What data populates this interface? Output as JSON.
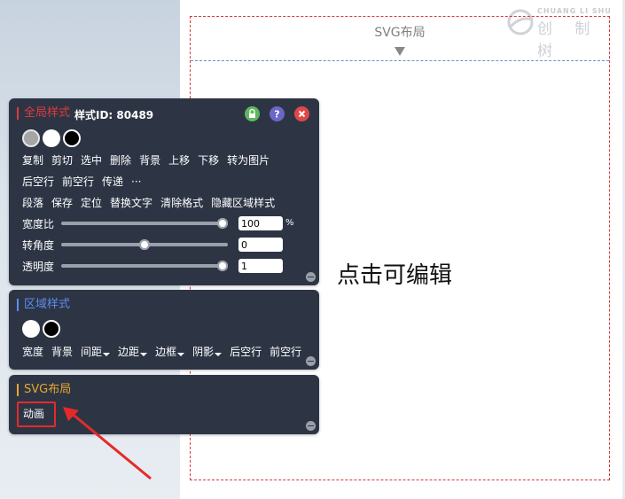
{
  "canvas": {
    "title": "SVG布局",
    "edit_text": "点击可编辑"
  },
  "logo": {
    "en": "CHUANG LI SHU",
    "cn": "创 制 树"
  },
  "global_panel": {
    "title": "全局样式",
    "style_id": "样式ID: 80489",
    "row1": [
      "复制",
      "剪切",
      "选中",
      "删除",
      "背景",
      "上移",
      "下移",
      "转为图片"
    ],
    "row2": [
      "后空行",
      "前空行",
      "传递",
      "···"
    ],
    "row3": [
      "段落",
      "保存",
      "定位",
      "替换文字",
      "清除格式",
      "隐藏区域样式"
    ],
    "sliders": [
      {
        "label": "宽度比",
        "value": "100",
        "unit": "%",
        "level": 1.0
      },
      {
        "label": "转角度",
        "value": "0",
        "unit": "",
        "level": 0.5
      },
      {
        "label": "透明度",
        "value": "1",
        "unit": "",
        "level": 1.0
      }
    ]
  },
  "region_panel": {
    "title": "区域样式",
    "buttons": [
      {
        "label": "宽度",
        "dropdown": false
      },
      {
        "label": "背景",
        "dropdown": false
      },
      {
        "label": "间距",
        "dropdown": true
      },
      {
        "label": "边距",
        "dropdown": true
      },
      {
        "label": "边框",
        "dropdown": true
      },
      {
        "label": "阴影",
        "dropdown": true
      },
      {
        "label": "后空行",
        "dropdown": false
      },
      {
        "label": "前空行",
        "dropdown": false
      }
    ]
  },
  "svg_panel": {
    "title": "SVG布局",
    "animation_label": "动画"
  },
  "colors": {
    "panel_bg": "#2d3545",
    "global_title": "#e23a3a",
    "region_title": "#5d8df0",
    "svg_title": "#e9a62c",
    "highlight": "#e52a2a"
  }
}
